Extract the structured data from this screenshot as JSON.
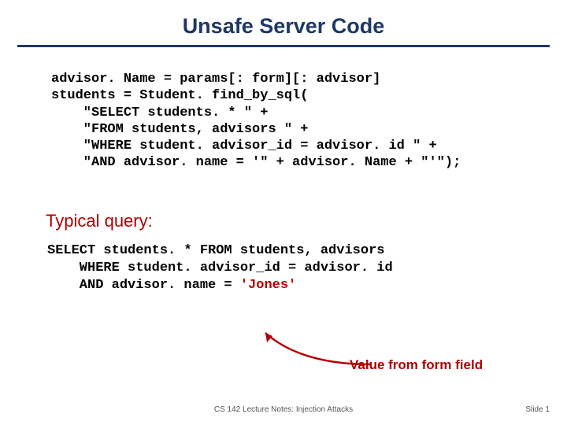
{
  "title": "Unsafe Server Code",
  "code1": {
    "l1": "advisor. Name = params[: form][: advisor]",
    "l2": "students = Student. find_by_sql(",
    "l3": "    \"SELECT students. * \" +",
    "l4": "    \"FROM students, advisors \" +",
    "l5": "    \"WHERE student. advisor_id = advisor. id \" +",
    "l6": "    \"AND advisor. name = '\" + advisor. Name + \"'\");"
  },
  "typical_label": "Typical query:",
  "code2": {
    "l1": "SELECT students. * FROM students, advisors",
    "l2": "    WHERE student. advisor_id = advisor. id",
    "l3_pre": "    AND advisor. name = ",
    "l3_jones": "'Jones'"
  },
  "annotation": "Value from form field",
  "footer": {
    "center": "CS 142 Lecture Notes: Injection Attacks",
    "right": "Slide 1"
  }
}
